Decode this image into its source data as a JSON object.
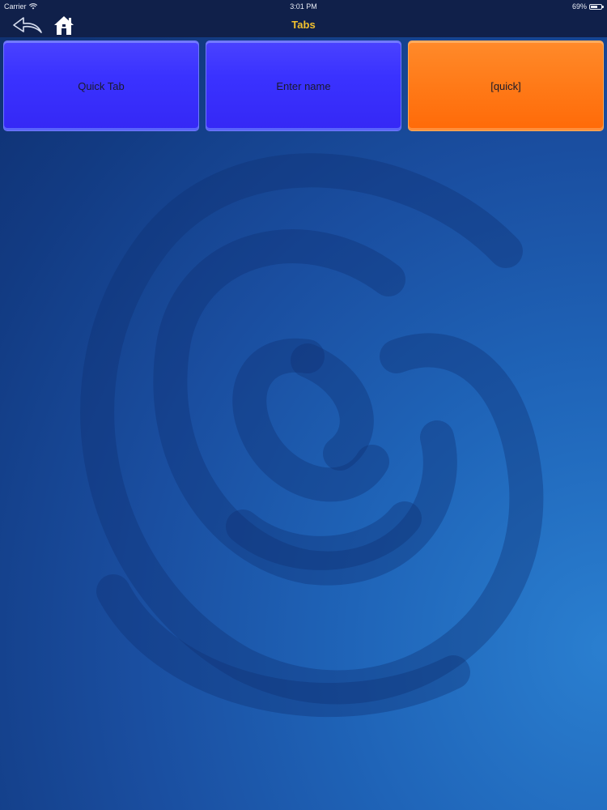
{
  "status_bar": {
    "carrier": "Carrier",
    "time": "3:01 PM",
    "battery": "69%",
    "battery_level": 0.69
  },
  "nav": {
    "title": "Tabs",
    "back_icon": "back-arrow-icon",
    "home_icon": "home-icon",
    "title_color": "#f2c12e"
  },
  "tabs": [
    {
      "label": "Quick Tab",
      "color": "#3a32ff"
    },
    {
      "label": "Enter name",
      "color": "#3a32ff"
    },
    {
      "label": "[quick]",
      "color": "#ff7a18"
    }
  ],
  "background": {
    "watermark_icon": "spiral-logo-icon"
  }
}
